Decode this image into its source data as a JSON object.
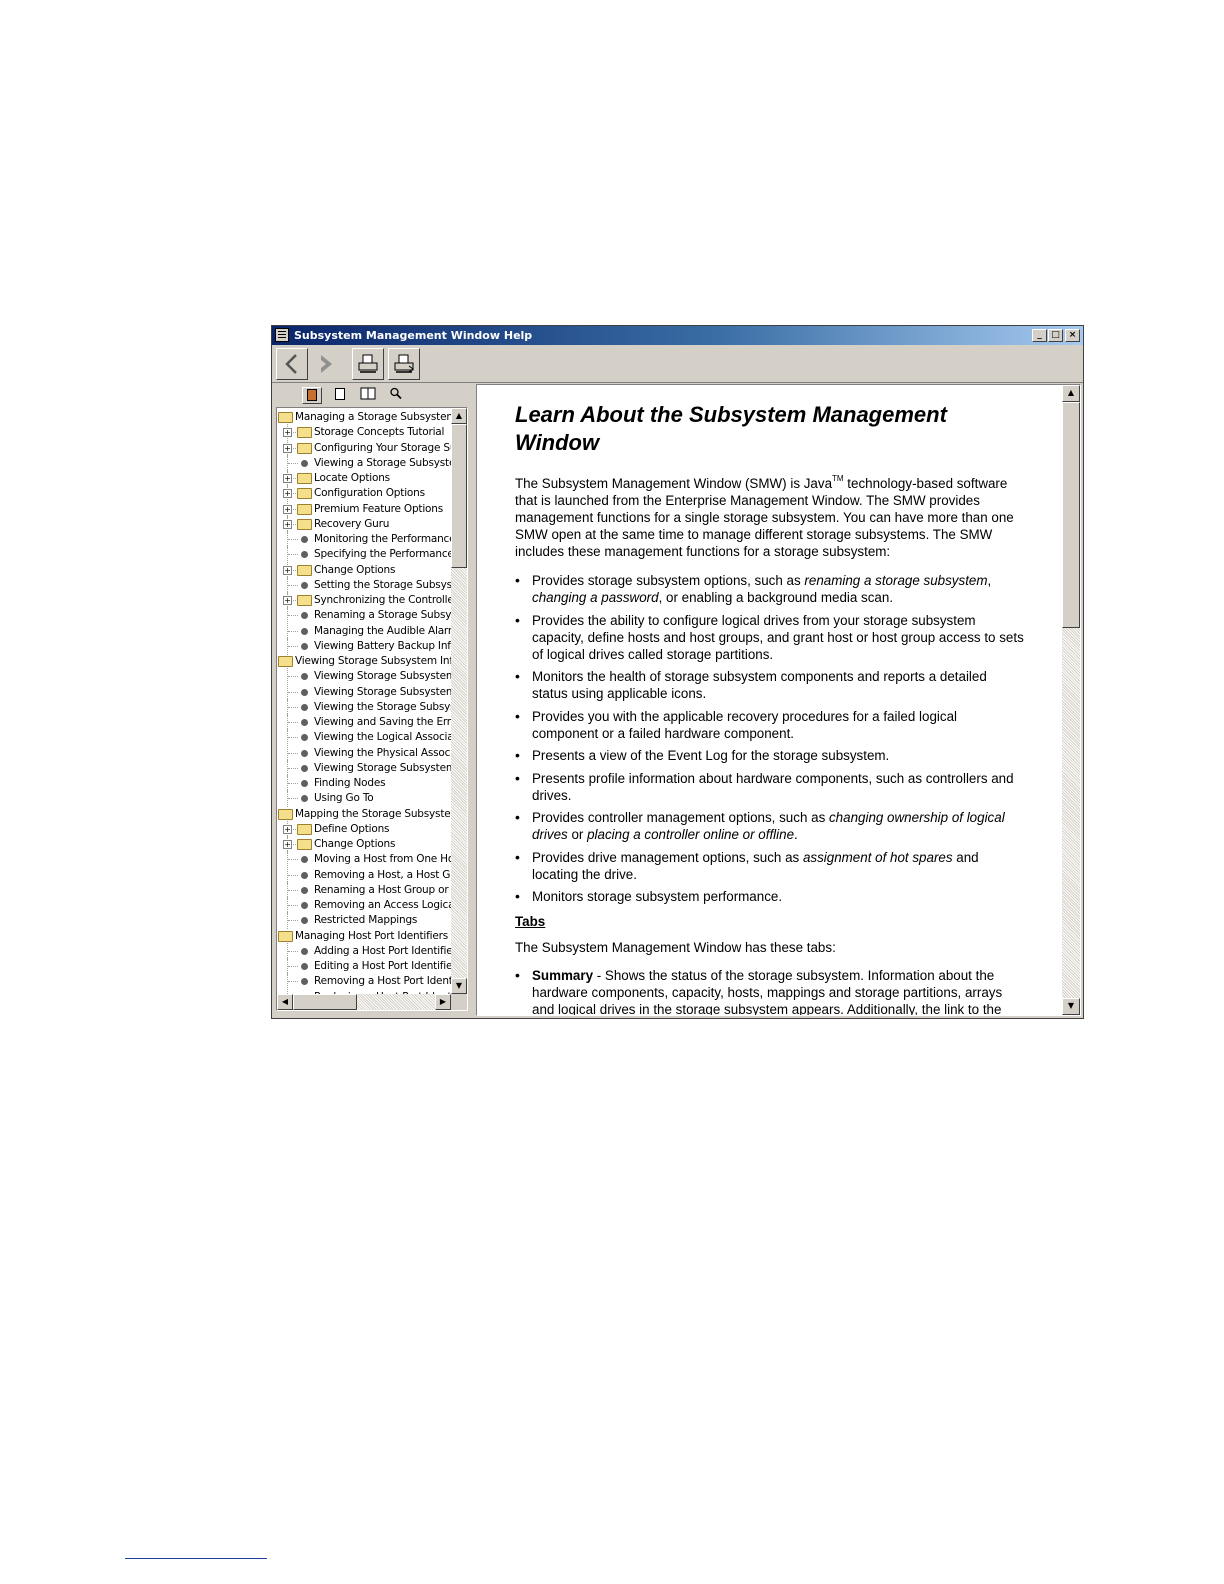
{
  "window": {
    "title": "Subsystem Management Window Help",
    "controls": {
      "minimize": "_",
      "maximize": "□",
      "close": "×"
    }
  },
  "toolbar": {
    "buttons": [
      {
        "name": "back",
        "icon": "back-arrow-icon",
        "glyph": "〈"
      },
      {
        "name": "forward",
        "icon": "forward-arrow-icon",
        "glyph": "〉"
      },
      {
        "name": "print",
        "icon": "printer-icon",
        "glyph": "⎙"
      },
      {
        "name": "print-options",
        "icon": "printer-options-icon",
        "glyph": "⎙"
      }
    ]
  },
  "nav_tabs": [
    {
      "name": "contents",
      "icon": "book-icon"
    },
    {
      "name": "index",
      "icon": "index-icon"
    },
    {
      "name": "glossary",
      "icon": "glossary-icon"
    },
    {
      "name": "search",
      "icon": "search-icon",
      "glyph": "🔍"
    }
  ],
  "tree": [
    {
      "label": "Managing a Storage Subsystem",
      "level": 0,
      "type": "folder-open"
    },
    {
      "label": "Storage Concepts Tutorial",
      "level": 1,
      "type": "folder",
      "expander": "+"
    },
    {
      "label": "Configuring Your Storage Sub",
      "level": 1,
      "type": "folder",
      "expander": "+"
    },
    {
      "label": "Viewing a Storage Subsystem",
      "level": 1,
      "type": "topic"
    },
    {
      "label": "Locate Options",
      "level": 1,
      "type": "folder",
      "expander": "+"
    },
    {
      "label": "Configuration Options",
      "level": 1,
      "type": "folder",
      "expander": "+"
    },
    {
      "label": "Premium Feature Options",
      "level": 1,
      "type": "folder",
      "expander": "+"
    },
    {
      "label": "Recovery Guru",
      "level": 1,
      "type": "folder",
      "expander": "+"
    },
    {
      "label": "Monitoring the Performance",
      "level": 1,
      "type": "topic"
    },
    {
      "label": "Specifying the Performance M",
      "level": 1,
      "type": "topic"
    },
    {
      "label": "Change Options",
      "level": 1,
      "type": "folder",
      "expander": "+"
    },
    {
      "label": "Setting the Storage Subsyste",
      "level": 1,
      "type": "topic"
    },
    {
      "label": "Synchronizing the Controller C",
      "level": 1,
      "type": "folder",
      "expander": "+"
    },
    {
      "label": "Renaming a Storage Subsyst",
      "level": 1,
      "type": "topic"
    },
    {
      "label": "Managing the Audible Alarms",
      "level": 1,
      "type": "topic"
    },
    {
      "label": "Viewing Battery Backup Infor",
      "level": 1,
      "type": "topic"
    },
    {
      "label": "Viewing Storage Subsystem Infor",
      "level": 0,
      "type": "folder-open"
    },
    {
      "label": "Viewing Storage Subsystem Lo",
      "level": 1,
      "type": "topic"
    },
    {
      "label": "Viewing Storage Subsystem P",
      "level": 1,
      "type": "topic"
    },
    {
      "label": "Viewing the Storage Subsyste",
      "level": 1,
      "type": "topic"
    },
    {
      "label": "Viewing and Saving the Error",
      "level": 1,
      "type": "topic"
    },
    {
      "label": "Viewing the Logical Associatio",
      "level": 1,
      "type": "topic"
    },
    {
      "label": "Viewing the Physical Associati",
      "level": 1,
      "type": "topic"
    },
    {
      "label": "Viewing Storage Subsystem C",
      "level": 1,
      "type": "topic"
    },
    {
      "label": "Finding Nodes",
      "level": 1,
      "type": "topic"
    },
    {
      "label": "Using Go To",
      "level": 1,
      "type": "topic"
    },
    {
      "label": "Mapping the Storage Subsystem",
      "level": 0,
      "type": "folder-open"
    },
    {
      "label": "Define Options",
      "level": 1,
      "type": "folder",
      "expander": "+"
    },
    {
      "label": "Change Options",
      "level": 1,
      "type": "folder",
      "expander": "+"
    },
    {
      "label": "Moving a Host from One Host",
      "level": 1,
      "type": "topic"
    },
    {
      "label": "Removing a Host, a Host Grou",
      "level": 1,
      "type": "topic"
    },
    {
      "label": "Renaming a Host Group or a H",
      "level": 1,
      "type": "topic"
    },
    {
      "label": "Removing an Access Logical D",
      "level": 1,
      "type": "topic"
    },
    {
      "label": "Restricted Mappings",
      "level": 1,
      "type": "topic"
    },
    {
      "label": "Managing Host Port Identifiers",
      "level": 0,
      "type": "folder-open"
    },
    {
      "label": "Adding a Host Port Identifier",
      "level": 1,
      "type": "topic"
    },
    {
      "label": "Editing a Host Port Identifier",
      "level": 1,
      "type": "topic"
    },
    {
      "label": "Removing a Host Port Identifi",
      "level": 1,
      "type": "topic"
    },
    {
      "label": "Replacing a Host Port Identifi",
      "level": 1,
      "type": "topic"
    }
  ],
  "content": {
    "title": "Learn About the Subsystem Management Window",
    "intro_before_tm": "The Subsystem Management Window (SMW) is Java",
    "tm": "TM",
    "intro_after_tm": " technology-based software that is launched from the Enterprise Management Window. The SMW provides management functions for a single storage subsystem. You can have more than one SMW open at the same time to manage different storage subsystems. The SMW includes these management functions for a storage subsystem:",
    "bullets": [
      {
        "parts": [
          {
            "t": "Provides storage subsystem options, such as "
          },
          {
            "t": "renaming a storage subsystem",
            "i": true
          },
          {
            "t": ", "
          },
          {
            "t": "changing a password",
            "i": true
          },
          {
            "t": ", or enabling a background media scan."
          }
        ]
      },
      {
        "parts": [
          {
            "t": "Provides the ability to configure logical drives from your storage subsystem capacity, define hosts and host groups, and grant host or host group access to sets of logical drives called storage partitions."
          }
        ]
      },
      {
        "parts": [
          {
            "t": "Monitors the health of storage subsystem components and reports a detailed status using applicable icons."
          }
        ]
      },
      {
        "parts": [
          {
            "t": "Provides you with the applicable recovery procedures for a failed logical component or a failed hardware component."
          }
        ]
      },
      {
        "parts": [
          {
            "t": "Presents a view of the Event Log for the storage subsystem."
          }
        ]
      },
      {
        "parts": [
          {
            "t": "Presents profile information about hardware components, such as controllers and drives."
          }
        ]
      },
      {
        "parts": [
          {
            "t": "Provides controller management options, such as "
          },
          {
            "t": "changing ownership of logical drives",
            "i": true
          },
          {
            "t": " or "
          },
          {
            "t": "placing a controller online or offline",
            "i": true
          },
          {
            "t": "."
          }
        ]
      },
      {
        "parts": [
          {
            "t": "Provides drive management options, such as "
          },
          {
            "t": "assignment of hot spares",
            "i": true
          },
          {
            "t": " and locating the drive."
          }
        ]
      },
      {
        "parts": [
          {
            "t": "Monitors storage subsystem performance."
          }
        ]
      }
    ],
    "tabs_heading": "Tabs",
    "tabs_intro": "The Subsystem Management Window has these tabs:",
    "tabs_items": [
      {
        "term": "Summary",
        "text": " - Shows the status of the storage subsystem. Information about the hardware components, capacity, hosts, mappings and storage partitions, arrays and logical drives in the storage subsystem appears. Additionally, the link to the"
      }
    ]
  },
  "scrollbars": {
    "tree_vertical_position": 0.0,
    "tree_vertical_visible_fraction": 0.26,
    "tree_horizontal_visible_fraction": 0.45,
    "content_vertical_position": 0.0,
    "content_vertical_visible_fraction": 0.38
  },
  "colors": {
    "title_bar_start": "#0a246a",
    "title_bar_end": "#a6caf0",
    "chrome": "#d4d0c8",
    "footnote_rule": "#1f3f9f"
  }
}
